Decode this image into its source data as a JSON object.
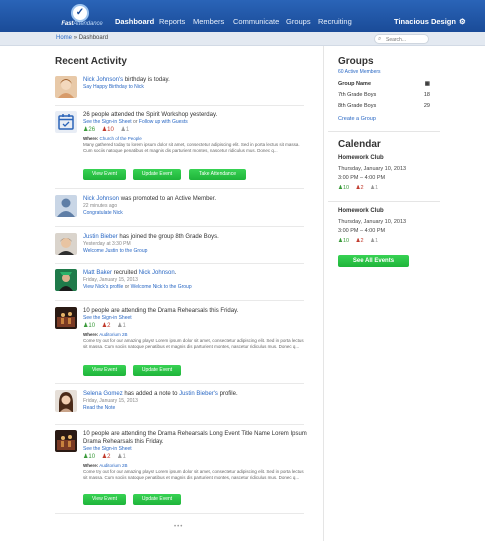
{
  "app": {
    "logo_text_bold": "Fast",
    "logo_text_thin": "Attendance"
  },
  "nav": {
    "items": [
      "Dashboard",
      "Reports",
      "Members",
      "Communicate",
      "Groups",
      "Recruiting"
    ],
    "active": "Dashboard",
    "account": "Tinacious Design"
  },
  "breadcrumb": {
    "home": "Home",
    "sep": "»",
    "current": "Dashboard"
  },
  "search": {
    "placeholder": "Search..."
  },
  "activity": {
    "title": "Recent Activity",
    "items": [
      {
        "name": "Nick Johnson's",
        "text": " birthday is today.",
        "link1": "Say Happy Birthday to Nick"
      },
      {
        "text": "26 people attended the Spirit Workshop yesterday.",
        "link1": "See the Sign-in Sheet",
        "or": "or",
        "link2": "Follow up with Guests",
        "stats": [
          "26",
          "10",
          "1"
        ],
        "where_label": "Where:",
        "where": "Church of the People",
        "desc": "Many gathered today to lorem ipsum dolor sit amet, consectetur adipiscing elit. Sed in porta lectus sit massa. Cum sociis natoque penatibus et magnis dis parturient montes, nascetur ridiculus mus. Donec q...",
        "buttons": [
          "View Event",
          "Update Event",
          "Take Attendance"
        ]
      },
      {
        "name": "Nick Johnson",
        "text": " was promoted to an Active Member.",
        "time": "22 minutes ago",
        "link1": "Congratulate Nick"
      },
      {
        "name": "Justin Bieber",
        "text": " has joined the group 8th Grade Boys.",
        "time": "Yesterday at 3:30 PM",
        "link1": "Welcome Justin to the Group"
      },
      {
        "name": "Matt Baker",
        "text": " recruited ",
        "name2": "Nick Johnson",
        "text2": ".",
        "time": "Friday, January 15, 2013",
        "link1": "View Nick's profile",
        "or": "or",
        "link2": "Welcome Nick to the Group"
      },
      {
        "text": "10 people are attending the Drama Rehearsals this Friday.",
        "link1": "See the Sign-in Sheet",
        "stats": [
          "10",
          "2",
          "1"
        ],
        "where_label": "Where:",
        "where": "Auditorium 2B",
        "desc": "Come try out for our amazing plays! Lorem ipsum dolor sit amet, consectetur adipiscing elit. Sed in porta lectus sit massa. Cum sociis natoque penatibus et magnis dis parturient montes, nascetur ridiculus mus. Donec q...",
        "buttons": [
          "View Event",
          "Update Event"
        ]
      },
      {
        "name": "Selena Gomez",
        "text": " has added a note to ",
        "name2": "Justin Bieber's",
        "text2": " profile.",
        "time": "Friday, January 15, 2013",
        "link1": "Read the Note"
      },
      {
        "text": "10 people are attending the Drama Rehearsals Long Event Title Name Lorem Ipsum",
        "text_b": "Drama Rehearsals this Friday.",
        "link1": "See the Sign-in Sheet",
        "stats": [
          "10",
          "2",
          "1"
        ],
        "where_label": "Where:",
        "where": "Auditorium 2B",
        "desc": "Come try out for our amazing plays! Lorem ipsum dolor sit amet, consectetur adipiscing elit. Sed in porta lectus sit massa. Cum sociis natoque penatibus et magnis dis parturient montes, nascetur ridiculus mus. Donec q...",
        "buttons": [
          "View Event",
          "Update Event"
        ]
      }
    ],
    "more": "•••"
  },
  "groups": {
    "title": "Groups",
    "active_count": "60 Active Members",
    "header": "Group Name",
    "rows": [
      {
        "name": "7th Grade Boys",
        "count": "18"
      },
      {
        "name": "8th Grade Boys",
        "count": "29"
      }
    ],
    "create": "Create a Group"
  },
  "calendar": {
    "title": "Calendar",
    "events": [
      {
        "name": "Homework Club",
        "date": "Thursday, January 10, 2013",
        "time": "3:00 PM – 4:00 PM",
        "stats": [
          "10",
          "2",
          "1"
        ]
      },
      {
        "name": "Homework Club",
        "date": "Thursday, January 10, 2013",
        "time": "3:00 PM – 4:00 PM",
        "stats": [
          "10",
          "2",
          "1"
        ]
      }
    ],
    "see_all": "See All Events"
  },
  "colors": {
    "header": "#1a4b98",
    "link": "#2a68c4",
    "button_green": "#1fb43a"
  }
}
